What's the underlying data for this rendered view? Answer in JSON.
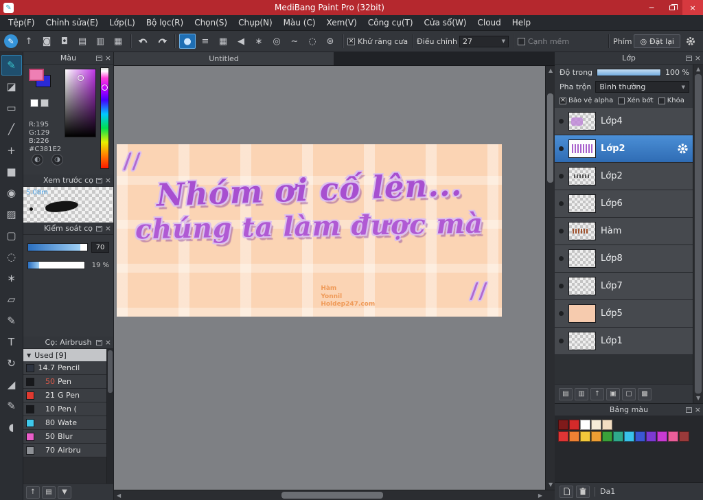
{
  "icons": {
    "minimize": "─",
    "close_window": "×",
    "close_panel": "×",
    "caret_down": "▼",
    "caret_up": "▲",
    "arrow_left": "◀",
    "arrow_right": "▶",
    "target": "◎"
  },
  "window": {
    "title": "MediBang Paint Pro (32bit)"
  },
  "menubar": {
    "items": [
      "Tệp(F)",
      "Chỉnh sửa(E)",
      "Lớp(L)",
      "Bộ lọc(R)",
      "Chọn(S)",
      "Chụp(N)",
      "Màu (C)",
      "Xem(V)",
      "Công cụ(T)",
      "Cửa sổ(W)",
      "Cloud",
      "Help"
    ]
  },
  "toolbar": {
    "left_icons": [
      {
        "name": "main-brush-icon",
        "glyph": "✎",
        "round": true
      },
      {
        "name": "export-icon",
        "glyph": "↑"
      },
      {
        "name": "comment-icon",
        "glyph": "◙"
      },
      {
        "name": "chat-icon",
        "glyph": "◘"
      },
      {
        "name": "document-icon",
        "glyph": "▤"
      },
      {
        "name": "layout-icon",
        "glyph": "▥"
      },
      {
        "name": "grid-icon",
        "glyph": "▦"
      }
    ],
    "brush_shape_icons": [
      {
        "name": "circle-tip-icon",
        "glyph": "●",
        "active": true
      },
      {
        "name": "lines-tip-icon",
        "glyph": "≡"
      },
      {
        "name": "grid-tip-icon",
        "glyph": "▦"
      },
      {
        "name": "triangle-tip-icon",
        "glyph": "◀"
      },
      {
        "name": "scatter-tip-icon",
        "glyph": "∗"
      },
      {
        "name": "rings-tip-icon",
        "glyph": "◎"
      },
      {
        "name": "curve-tip-icon",
        "glyph": "∼"
      },
      {
        "name": "dashed-circle-tip-icon",
        "glyph": "◌"
      },
      {
        "name": "tip-settings-gear-icon",
        "glyph": "⊛"
      }
    ],
    "antialias_label": "Khử răng cưa",
    "antialias_mark": "×",
    "adjust_label": "Điều chỉnh",
    "adjust_value": "27",
    "soft_edge_label": "Cạnh mềm",
    "soft_edge_mark": "",
    "key_label": "Phím",
    "reset_label": "Đặt lại"
  },
  "toolstrip": {
    "tools": [
      {
        "name": "brush-tool",
        "glyph": "✎",
        "active": true
      },
      {
        "name": "eraser-tool",
        "glyph": "◪"
      },
      {
        "name": "shape-tool",
        "glyph": "▭"
      },
      {
        "name": "divide-tool",
        "glyph": "╱"
      },
      {
        "name": "move-tool",
        "glyph": "+"
      },
      {
        "name": "fill-shape-tool",
        "glyph": "■"
      },
      {
        "name": "bucket-tool",
        "glyph": "◉"
      },
      {
        "name": "gradient-tool",
        "glyph": "▨"
      },
      {
        "name": "select-tool",
        "glyph": "▢"
      },
      {
        "name": "lasso-tool",
        "glyph": "◌"
      },
      {
        "name": "magic-wand-tool",
        "glyph": "∗"
      },
      {
        "name": "poly-select-tool",
        "glyph": "▱"
      },
      {
        "name": "select-pen-tool",
        "glyph": "✎"
      },
      {
        "name": "text-tool",
        "glyph": "T"
      },
      {
        "name": "rotate-tool",
        "glyph": "↻"
      },
      {
        "name": "eyedropper-tool",
        "glyph": "◢"
      },
      {
        "name": "pen-tool",
        "glyph": "✎"
      },
      {
        "name": "hand-tool",
        "glyph": "◖"
      }
    ]
  },
  "color_panel": {
    "title": "Màu",
    "foreground_color": "#ee7fb4",
    "background_color": "#2a2ad6",
    "mini_swatch_1": "#ffffff",
    "mini_swatch_2": "#c9cbce",
    "current_color": "#C381E2",
    "rgb_lines": [
      "R:195",
      "G:129",
      "B:226",
      "#C381E2"
    ],
    "bottom_icons": [
      {
        "name": "color-web-icon",
        "glyph": "◐"
      },
      {
        "name": "color-set-icon",
        "glyph": "◑"
      }
    ]
  },
  "brush_preview": {
    "title": "Xem trước cọ",
    "size_label": "5.08m"
  },
  "brush_control": {
    "title": "Kiểm soát cọ",
    "value1": "70",
    "value2": "19 %"
  },
  "brush_panel": {
    "title": "Cọ: Airbrush",
    "group_label": "Used [9]",
    "brushes": [
      {
        "size": "14.7",
        "name": "Pencil",
        "color": "#2e3440"
      },
      {
        "size": "50",
        "name": "Pen",
        "color": "#17181b",
        "size_color": "#e05a4a"
      },
      {
        "size": "21",
        "name": "G Pen",
        "color": "#e03a30"
      },
      {
        "size": "10",
        "name": "Pen (",
        "color": "#17181b"
      },
      {
        "size": "80",
        "name": "Wate",
        "color": "#3fc8ea"
      },
      {
        "size": "50",
        "name": "Blur",
        "color": "#ea5ec8"
      },
      {
        "size": "70",
        "name": "Airbru",
        "color": "#8e9196"
      }
    ],
    "foot_icons": [
      {
        "name": "brush-upload-button",
        "glyph": "↑"
      },
      {
        "name": "add-brush-button",
        "glyph": "▤"
      },
      {
        "name": "brush-menu-button",
        "glyph": "▼"
      }
    ]
  },
  "canvas": {
    "tab_title": "Untitled",
    "artwork": {
      "line1": "Nhóm ơi cố lên...",
      "line2": "chúng ta làm được mà",
      "watermark": [
        "Hàm",
        "Yonnil",
        "Holdep247.com"
      ]
    }
  },
  "layer_panel": {
    "title": "Lớp",
    "opacity_label": "Độ trong",
    "opacity_value": "100 %",
    "blend_label": "Pha trộn",
    "blend_value": "Bình thường",
    "checks": [
      {
        "label": "Bảo vệ alpha",
        "mark": "×",
        "checked": true
      },
      {
        "label": "Xén bớt",
        "mark": "",
        "checked": false
      },
      {
        "label": "Khóa",
        "mark": "",
        "checked": false
      }
    ],
    "layers": [
      {
        "name": "Lớp4",
        "thumb": "marks-purple"
      },
      {
        "name": "Lớp2",
        "thumb": "text-purple",
        "selected": true
      },
      {
        "name": "Lớp2",
        "thumb": "marks-dark"
      },
      {
        "name": "Lớp6",
        "thumb": "checker"
      },
      {
        "name": "Hàm",
        "thumb": "marks-red"
      },
      {
        "name": "Lớp8",
        "thumb": "checker"
      },
      {
        "name": "Lớp7",
        "thumb": "checker"
      },
      {
        "name": "Lớp5",
        "thumb": "peach"
      },
      {
        "name": "Lớp1",
        "thumb": "checker"
      }
    ],
    "foot_icons": [
      {
        "name": "add-layer-button",
        "glyph": "▤"
      },
      {
        "name": "add-pixel-layer-button",
        "glyph": "▥"
      },
      {
        "name": "merge-layer-button",
        "glyph": "↑"
      },
      {
        "name": "add-folder-button",
        "glyph": "▣"
      },
      {
        "name": "folder-button",
        "glyph": "▢"
      },
      {
        "name": "duplicate-layer-button",
        "glyph": "▩"
      }
    ]
  },
  "palette_panel": {
    "title": "Bảng màu",
    "set_label": "Da1",
    "row1": [
      "#7f1a1a",
      "#d42a2a",
      "#ffffff",
      "#f6ecd8",
      "#f2ddc2"
    ],
    "row2": [
      "#df3535",
      "#ee8133",
      "#f2c83a",
      "#ee9e33",
      "#3aa23a",
      "#2fa98b",
      "#39c2eb",
      "#3a57d3",
      "#7c3ad3",
      "#c93ad3",
      "#eb5e99",
      "#9a3a3a"
    ]
  }
}
